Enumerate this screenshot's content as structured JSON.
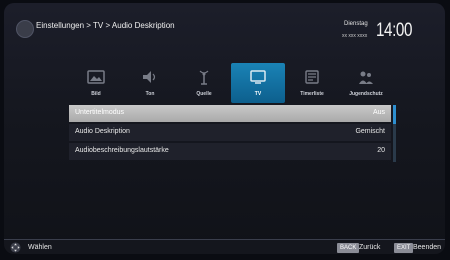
{
  "header": {
    "breadcrumb": "Einstellungen > TV > Audio Deskription",
    "day": "Dienstag",
    "date": "xx xxx xxxx",
    "time": "14:00"
  },
  "tabs": [
    {
      "label": "Bild",
      "icon": "picture-icon"
    },
    {
      "label": "Ton",
      "icon": "speaker-icon"
    },
    {
      "label": "Quelle",
      "icon": "antenna-icon"
    },
    {
      "label": "TV",
      "icon": "tv-icon"
    },
    {
      "label": "Timerliste",
      "icon": "timer-list-icon"
    },
    {
      "label": "Jugendschutz",
      "icon": "parental-lock-icon"
    }
  ],
  "active_tab": "TV",
  "menu": {
    "rows": [
      {
        "label": "Untertitelmodus",
        "value": "Aus"
      },
      {
        "label": "Audio Deskription",
        "value": "Gemischt"
      },
      {
        "label": "Audiobeschreibungslautstärke",
        "value": "20"
      }
    ]
  },
  "footer": {
    "select_label": "Wählen",
    "back_key": "BACK",
    "back_label": "Zurück",
    "exit_key": "EXIT",
    "exit_label": "Beenden"
  },
  "colors": {
    "accent": "#1a83b6",
    "selected_row": "#b9b9b9",
    "background": "#15171f"
  }
}
